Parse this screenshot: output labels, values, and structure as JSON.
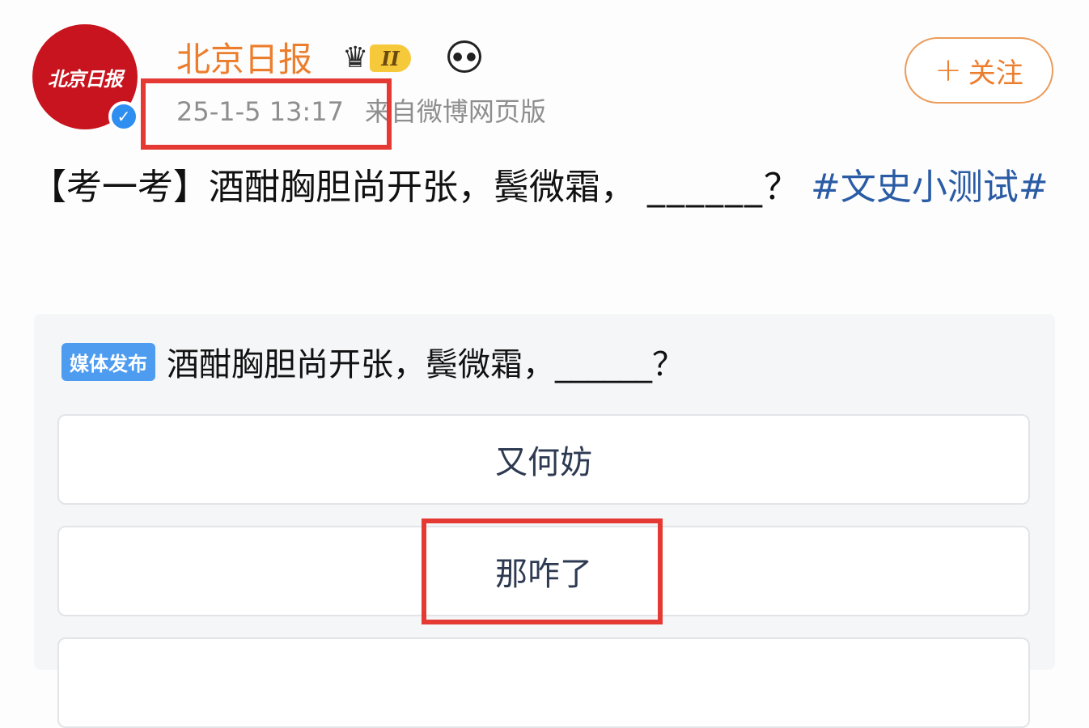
{
  "post": {
    "avatar_text": "北京日报",
    "username": "北京日报",
    "member_level": "II",
    "timestamp": "25-1-5 13:17",
    "source": "来自微博网页版",
    "follow_label": "关注",
    "text_prefix": "【考一考】酒酣胸胆尚开张，鬓微霜，",
    "text_blank": "______",
    "text_suffix": "？",
    "topic": "#文史小测试#"
  },
  "poll": {
    "badge": "媒体发布",
    "question": "酒酣胸胆尚开张，鬓微霜，______？",
    "options": [
      "又何妨",
      "那咋了",
      ""
    ]
  },
  "colors": {
    "username": "#ec7d2c",
    "topic": "#2a5ba5",
    "highlight": "#e43a33",
    "badge": "#4d9cf0",
    "avatar": "#c8141e"
  },
  "icons": [
    "verified-icon",
    "crown-icon",
    "panda-icon",
    "plus-icon"
  ]
}
